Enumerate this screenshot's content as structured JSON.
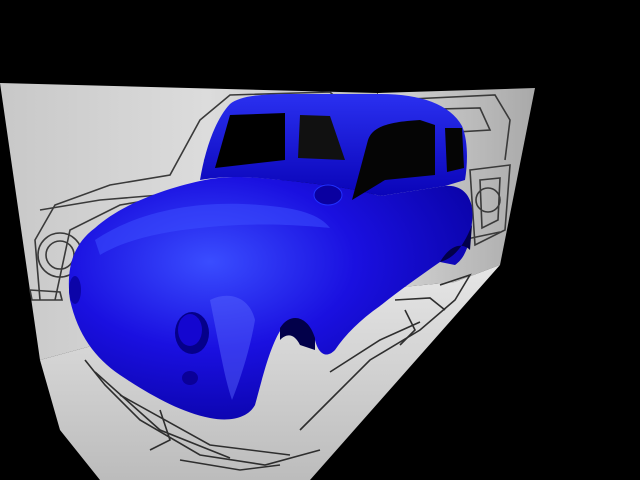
{
  "scene": {
    "subject": "car-body-3d-model",
    "background_color": "#000000",
    "body_color": "#0a00c8",
    "body_highlight_color": "#4a5cff",
    "body_shadow_color": "#02005a",
    "blueprint_panel_color": "#d6d6d6",
    "blueprint_line_color": "#3a3a3a",
    "views": [
      "side-blueprint",
      "top-blueprint",
      "rear-blueprint"
    ]
  }
}
